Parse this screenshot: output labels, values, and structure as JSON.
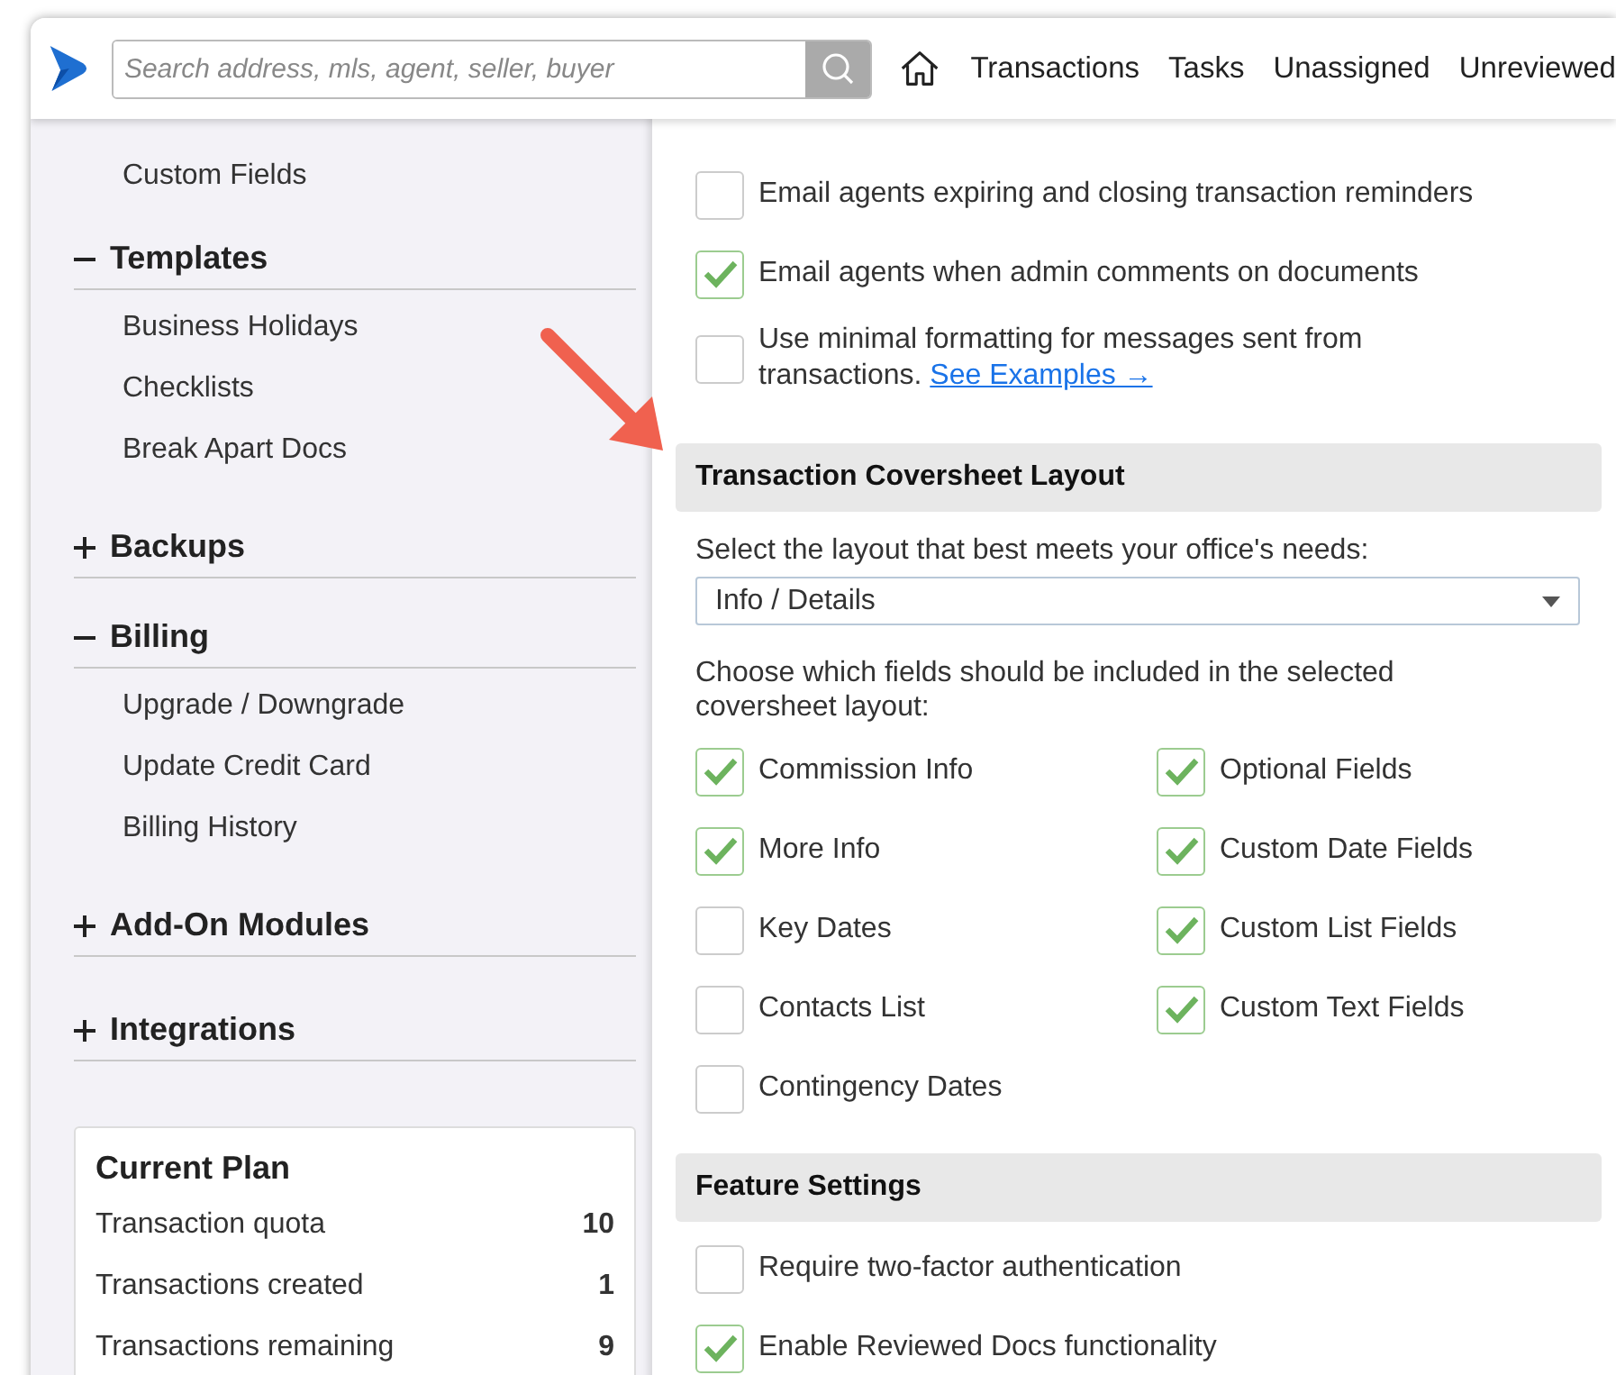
{
  "header": {
    "search": {
      "placeholder": "Search address, mls, agent, seller, buyer"
    },
    "nav": [
      "Transactions",
      "Tasks",
      "Unassigned",
      "Unreviewed"
    ]
  },
  "sidebar": {
    "top_items": [
      "Custom Fields"
    ],
    "sections": [
      {
        "title": "Templates",
        "expanded": true,
        "items": [
          "Business Holidays",
          "Checklists",
          "Break Apart Docs"
        ]
      },
      {
        "title": "Backups",
        "expanded": false
      },
      {
        "title": "Billing",
        "expanded": true,
        "items": [
          "Upgrade / Downgrade",
          "Update Credit Card",
          "Billing History"
        ]
      },
      {
        "title": "Add-On Modules",
        "expanded": false
      },
      {
        "title": "Integrations",
        "expanded": false
      }
    ],
    "plan": {
      "title": "Current Plan",
      "rows": [
        {
          "label": "Transaction quota",
          "value": "10"
        },
        {
          "label": "Transactions created",
          "value": "1"
        },
        {
          "label": "Transactions remaining",
          "value": "9"
        }
      ]
    }
  },
  "email_options": [
    {
      "label": "Email agents expiring and closing transaction reminders",
      "checked": false
    },
    {
      "label": "Email agents when admin comments on documents",
      "checked": true
    },
    {
      "label": "Use minimal formatting for messages sent from transactions.",
      "link": "See Examples →",
      "checked": false
    }
  ],
  "coversheet": {
    "title": "Transaction Coversheet Layout",
    "select_label": "Select the layout that best meets your office's needs:",
    "select_value": "Info / Details",
    "fields_label": "Choose which fields should be included in the selected coversheet layout:",
    "fields": [
      {
        "label": "Commission Info",
        "checked": true
      },
      {
        "label": "Optional Fields",
        "checked": true
      },
      {
        "label": "More Info",
        "checked": true
      },
      {
        "label": "Custom Date Fields",
        "checked": true
      },
      {
        "label": "Key Dates",
        "checked": false
      },
      {
        "label": "Custom List Fields",
        "checked": true
      },
      {
        "label": "Contacts List",
        "checked": false
      },
      {
        "label": "Custom Text Fields",
        "checked": true
      },
      {
        "label": "Contingency Dates",
        "checked": false
      }
    ]
  },
  "feature_settings": {
    "title": "Feature Settings",
    "options": [
      {
        "label": "Require two-factor authentication",
        "checked": false
      },
      {
        "label": "Enable Reviewed Docs functionality",
        "checked": true
      }
    ]
  }
}
